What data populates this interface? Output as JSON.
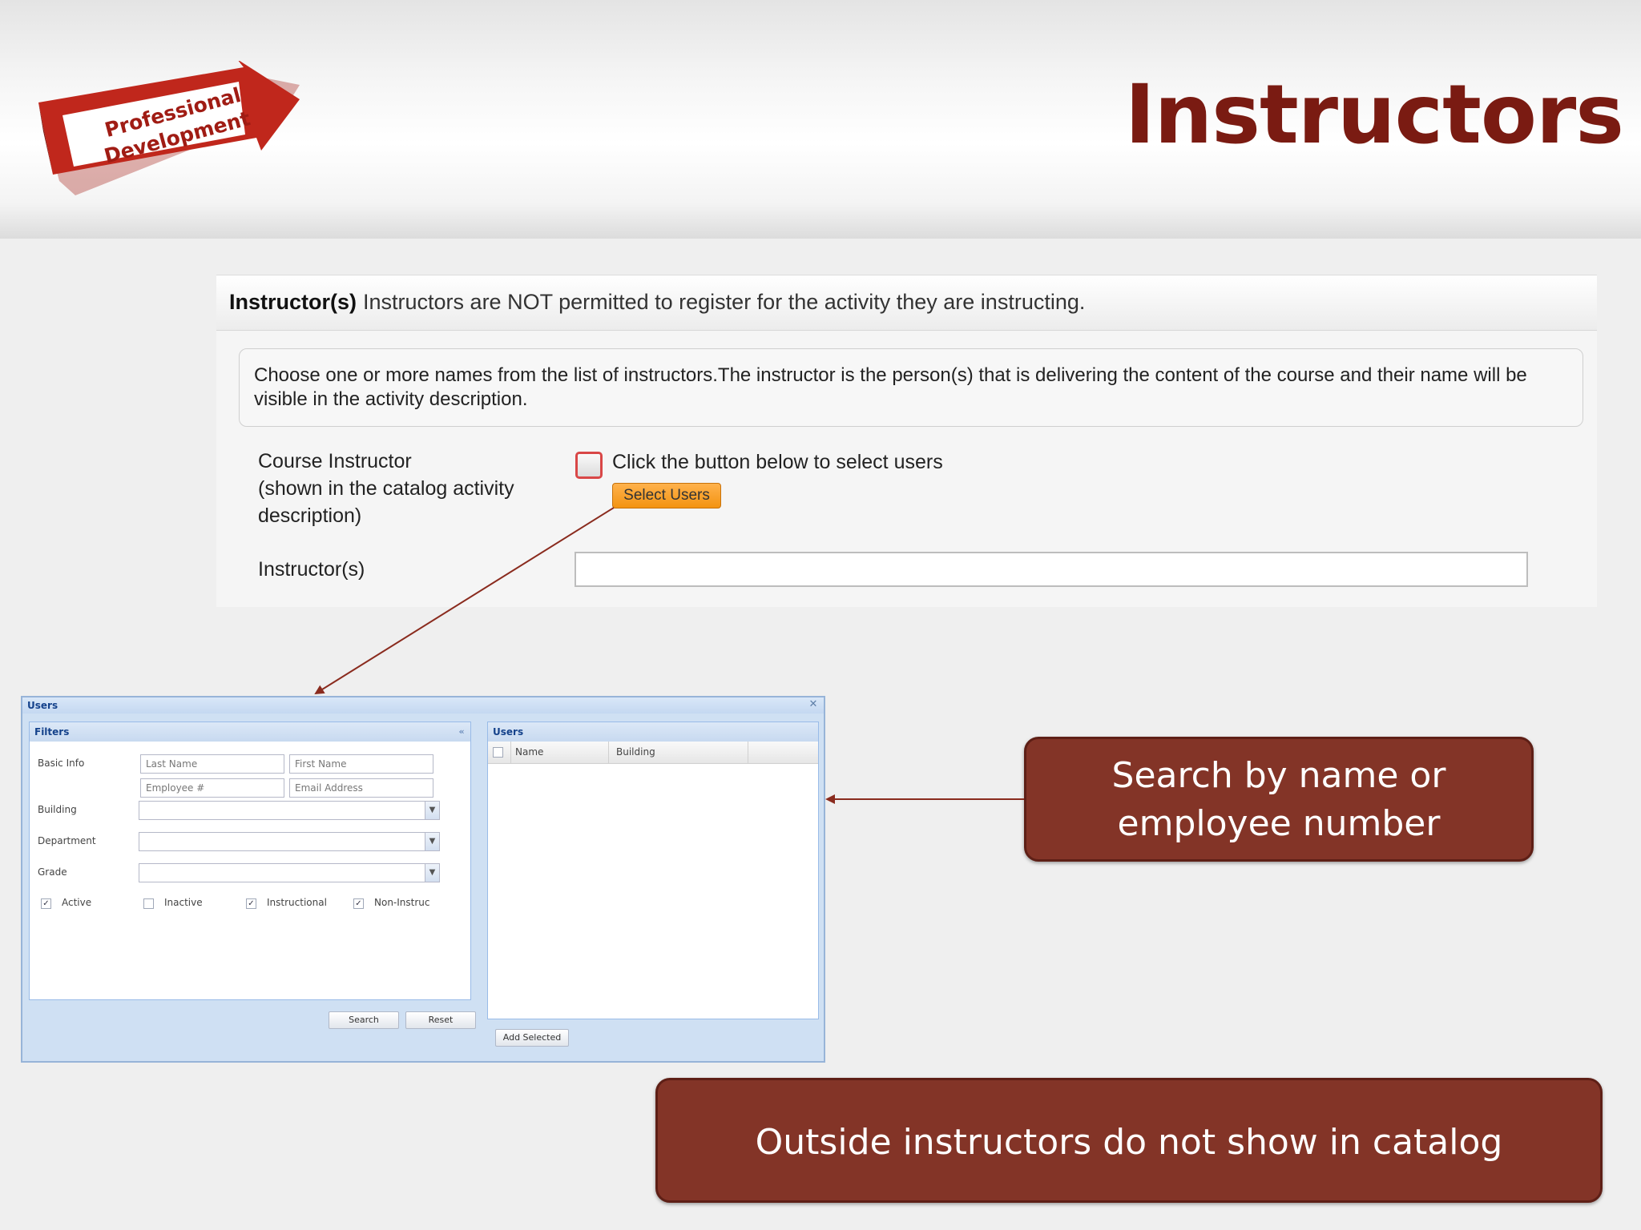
{
  "slide": {
    "title": "Instructors",
    "logo_line1": "Professional",
    "logo_line2": "Development"
  },
  "panel": {
    "header_bold": "Instructor(s)",
    "header_text": "Instructors are NOT permitted to register for the activity they are instructing.",
    "info_text": "Choose one or more names from the list of instructors.The instructor is the person(s) that is delivering the content of the course and their name will be visible in the activity description.",
    "course_instructor_label_1": "Course Instructor",
    "course_instructor_label_2": "(shown in the catalog activity",
    "course_instructor_label_3": "description)",
    "select_prompt": "Click the button below to select users",
    "select_button": "Select Users",
    "instructors_label": "Instructor(s)",
    "instructors_value": ""
  },
  "dialog": {
    "title": "Users",
    "filters": {
      "title": "Filters",
      "basic_info_label": "Basic Info",
      "last_name_placeholder": "Last Name",
      "first_name_placeholder": "First Name",
      "employee_placeholder": "Employee #",
      "email_placeholder": "Email Address",
      "building_label": "Building",
      "department_label": "Department",
      "grade_label": "Grade",
      "checkboxes": [
        {
          "label": "Active",
          "checked": true
        },
        {
          "label": "Inactive",
          "checked": false
        },
        {
          "label": "Instructional",
          "checked": true
        },
        {
          "label": "Non-Instruc",
          "checked": true
        }
      ],
      "search_button": "Search",
      "reset_button": "Reset"
    },
    "users": {
      "title": "Users",
      "columns": [
        "Name",
        "Building"
      ],
      "add_selected_button": "Add Selected"
    }
  },
  "callouts": {
    "search_line1": "Search by name or",
    "search_line2": "employee number",
    "outside": "Outside instructors do not show in catalog"
  },
  "colors": {
    "title": "#7a1b12",
    "callout": "#833427",
    "button_orange": "#f39411",
    "dialog_blue": "#cfe0f3"
  }
}
